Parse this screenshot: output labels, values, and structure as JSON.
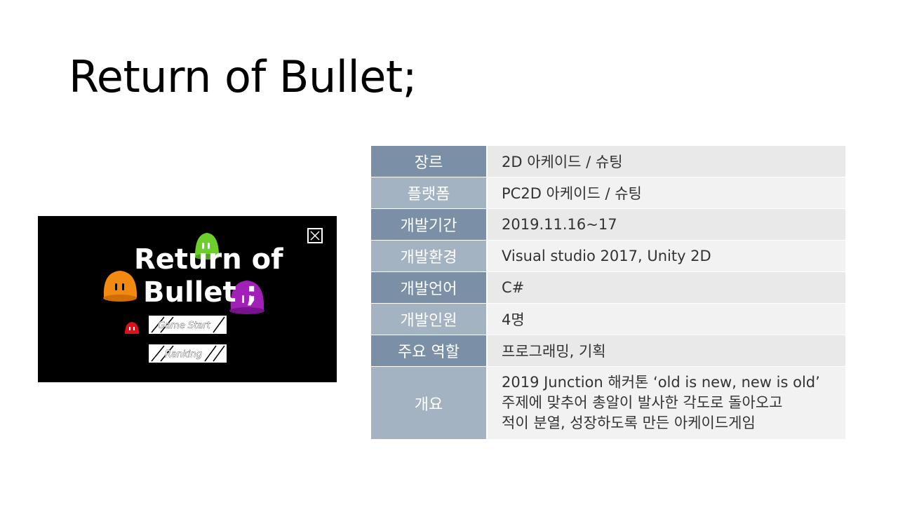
{
  "slide": {
    "title": "Return of Bullet;"
  },
  "game_screenshot": {
    "title_line1": "Return of",
    "title_line2": "Bullet ;",
    "start_button_label": "Game Start",
    "ranking_button_label": "Ranking",
    "colors": {
      "background": "#000000",
      "slime_green": "#6ccf2a",
      "slime_orange": "#f28a12",
      "slime_purple": "#a020b8",
      "slime_red": "#e0101a"
    }
  },
  "table": {
    "rows": [
      {
        "label": "장르",
        "value": "2D 아케이드 / 슈팅"
      },
      {
        "label": "플랫폼",
        "value": "PC2D 아케이드 / 슈팅"
      },
      {
        "label": "개발기간",
        "value": "2019.11.16~17"
      },
      {
        "label": "개발환경",
        "value": "Visual studio 2017, Unity 2D"
      },
      {
        "label": "개발언어",
        "value": "C#"
      },
      {
        "label": "개발인원",
        "value": "4명"
      },
      {
        "label": "주요 역할",
        "value": "프로그래밍, 기획"
      },
      {
        "label": "개요",
        "lines": [
          "2019 Junction 해커톤 ‘old is new, new is old’",
          "주제에 맞추어 총알이 발사한 각도로 돌아오고",
          "적이 분열, 성장하도록 만든 아케이드게임"
        ]
      }
    ],
    "colors": {
      "label_dark": "#7b90a6",
      "label_light": "#a4b3c1",
      "value_dark": "#e9e9e9",
      "value_light": "#f2f2f2"
    }
  }
}
